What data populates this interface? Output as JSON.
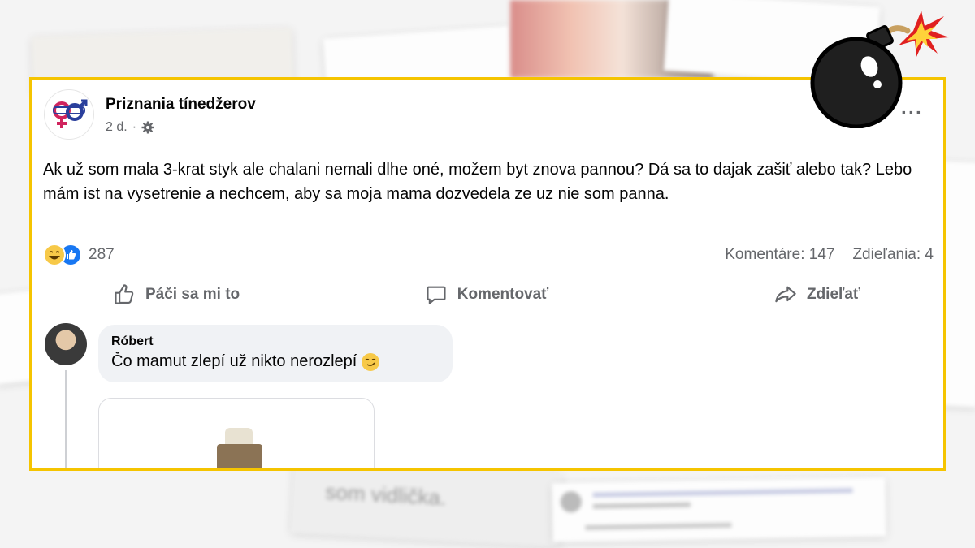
{
  "post": {
    "page_name": "Priznania tínedžerov",
    "time": "2 d.",
    "more": "···",
    "text": "Ak už som mala 3-krat styk ale chalani nemali dlhe oné, možem byt znova pannou? Dá sa to dajak zašiť alebo tak? Lebo mám ist na vysetrenie a nechcem, aby sa moja mama dozvedela ze uz nie som panna.",
    "reactions": {
      "icons": [
        "haha",
        "like"
      ],
      "count": "287"
    },
    "comments_count": "Komentáre: 147",
    "shares_count": "Zdieľania: 4"
  },
  "actions": {
    "like": "Páči sa mi to",
    "comment": "Komentovať",
    "share": "Zdieľať"
  },
  "comment": {
    "author": "Róbert",
    "text": "Čo mamut zlepí už nikto nerozlepí"
  },
  "background": {
    "blurred_text": "som vidlička."
  },
  "colors": {
    "frame": "#f5c400",
    "like_blue": "#1877f2",
    "secondary_text": "#65676b",
    "bubble_bg": "#f0f2f5"
  }
}
